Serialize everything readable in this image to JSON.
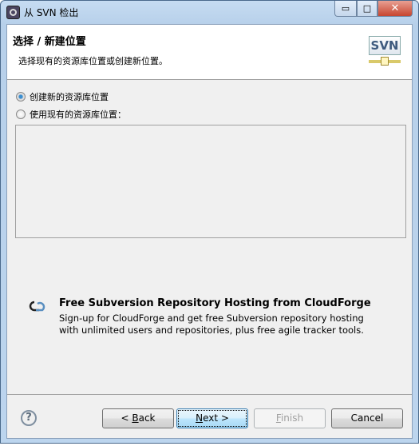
{
  "window": {
    "title": "从 SVN 检出",
    "controls": {
      "minimize": "▭",
      "maximize": "□",
      "close": "✕"
    }
  },
  "header": {
    "title": "选择 / 新建位置",
    "description": "选择现有的资源库位置或创建新位置。",
    "logo_text": "SVN"
  },
  "options": [
    {
      "label": "创建新的资源库位置",
      "selected": true
    },
    {
      "label": "使用现有的资源库位置：",
      "selected": false
    }
  ],
  "cloudforge": {
    "icon": "cloud-icon",
    "title": "Free Subversion Repository Hosting from CloudForge",
    "line1": "Sign-up for CloudForge and get free Subversion repository hosting",
    "line2": "with unlimited users and repositories, plus free agile tracker tools."
  },
  "buttons": {
    "help": "?",
    "back_prefix": "< ",
    "back_mn": "B",
    "back_rest": "ack",
    "next_mn": "N",
    "next_rest": "ext >",
    "finish_mn": "F",
    "finish_rest": "inish",
    "cancel": "Cancel"
  }
}
